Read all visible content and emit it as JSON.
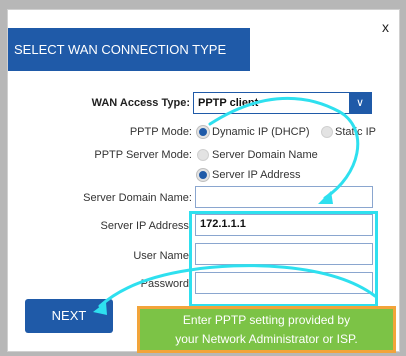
{
  "dialog": {
    "title": "SELECT WAN CONNECTION TYPE",
    "close_label": "x"
  },
  "form": {
    "wan_access_type": {
      "label": "WAN Access Type:",
      "value": "PPTP client"
    },
    "pptp_mode": {
      "label": "PPTP Mode:",
      "options": [
        "Dynamic IP (DHCP)",
        "Static IP"
      ],
      "selected": "Dynamic IP (DHCP)"
    },
    "pptp_server_mode": {
      "label": "PPTP Server Mode:",
      "options": [
        "Server Domain Name",
        "Server IP Address"
      ],
      "selected": "Server IP Address"
    },
    "server_domain_name": {
      "label": "Server Domain Name:",
      "value": ""
    },
    "server_ip_address": {
      "label": "Server IP Address:",
      "value": "172.1.1.1"
    },
    "user_name": {
      "label": "User Name:",
      "value": ""
    },
    "password": {
      "label": "Password:",
      "value": ""
    }
  },
  "actions": {
    "next_label": "NEXT"
  },
  "tip": {
    "line1": "Enter PPTP setting provided by",
    "line2": "your Network Administrator or ISP."
  },
  "colors": {
    "accent": "#1f5aa8",
    "highlight": "#2ee0ef",
    "tip_bg": "#7cc346",
    "tip_border": "#f2a43a"
  }
}
